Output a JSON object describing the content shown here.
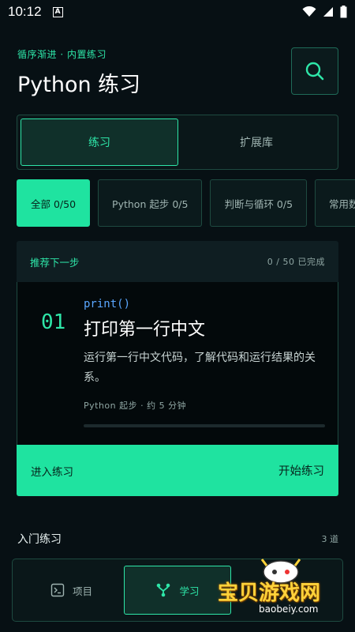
{
  "status_bar": {
    "time": "10:12",
    "badge": "A"
  },
  "header": {
    "subtitle": "循序渐进 · 内置练习",
    "title": "Python 练习"
  },
  "segmented": {
    "tabs": [
      {
        "label": "练习",
        "active": true
      },
      {
        "label": "扩展库",
        "active": false
      }
    ]
  },
  "chips": [
    {
      "label": "全部 0/50",
      "active": true
    },
    {
      "label": "Python 起步 0/5",
      "active": false
    },
    {
      "label": "判断与循环 0/5",
      "active": false
    },
    {
      "label": "常用数",
      "active": false
    }
  ],
  "recommend": {
    "title": "推荐下一步",
    "progress": "0 / 50 已完成",
    "card": {
      "number": "01",
      "code": "print()",
      "title": "打印第一行中文",
      "desc": "运行第一行中文代码，了解代码和运行结果的关系。",
      "meta": "Python 起步 · 约 5 分钟",
      "progress": 0
    },
    "cta_left": "进入练习",
    "cta_right": "开始练习"
  },
  "section": {
    "title": "入门练习",
    "count": "3 道"
  },
  "bottom_nav": {
    "items": [
      {
        "label": "项目",
        "icon": "terminal-icon",
        "active": false
      },
      {
        "label": "学习",
        "icon": "branch-icon",
        "active": true
      }
    ]
  },
  "watermark": {
    "text": "宝贝游戏网",
    "url": "baobeiy.com"
  },
  "colors": {
    "accent": "#2ee6a8",
    "background": "#071014",
    "cta": "#1fe3a0"
  }
}
